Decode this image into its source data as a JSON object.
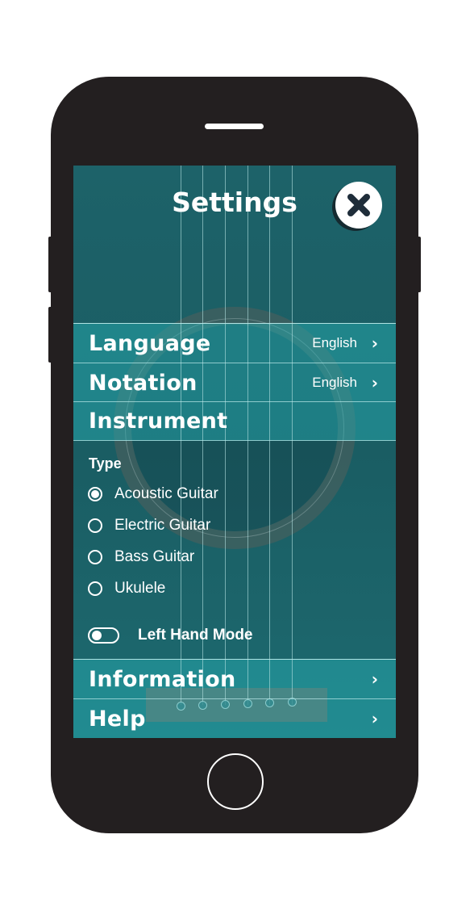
{
  "header": {
    "title": "Settings",
    "close_icon": "close-icon"
  },
  "menu": {
    "language": {
      "label": "Language",
      "value": "English"
    },
    "notation": {
      "label": "Notation",
      "value": "English"
    },
    "instrument": {
      "label": "Instrument"
    },
    "information": {
      "label": "Information"
    },
    "help": {
      "label": "Help"
    }
  },
  "instrument": {
    "type_label": "Type",
    "options": [
      {
        "label": "Acoustic Guitar",
        "selected": true
      },
      {
        "label": "Electric Guitar",
        "selected": false
      },
      {
        "label": "Bass Guitar",
        "selected": false
      },
      {
        "label": "Ukulele",
        "selected": false
      }
    ],
    "left_hand_mode": {
      "label": "Left Hand Mode",
      "enabled": false
    }
  },
  "colors": {
    "background": "#1b5f66",
    "band": "#1c8c91",
    "phone": "#231f20",
    "close_x": "#1f2d3a"
  }
}
